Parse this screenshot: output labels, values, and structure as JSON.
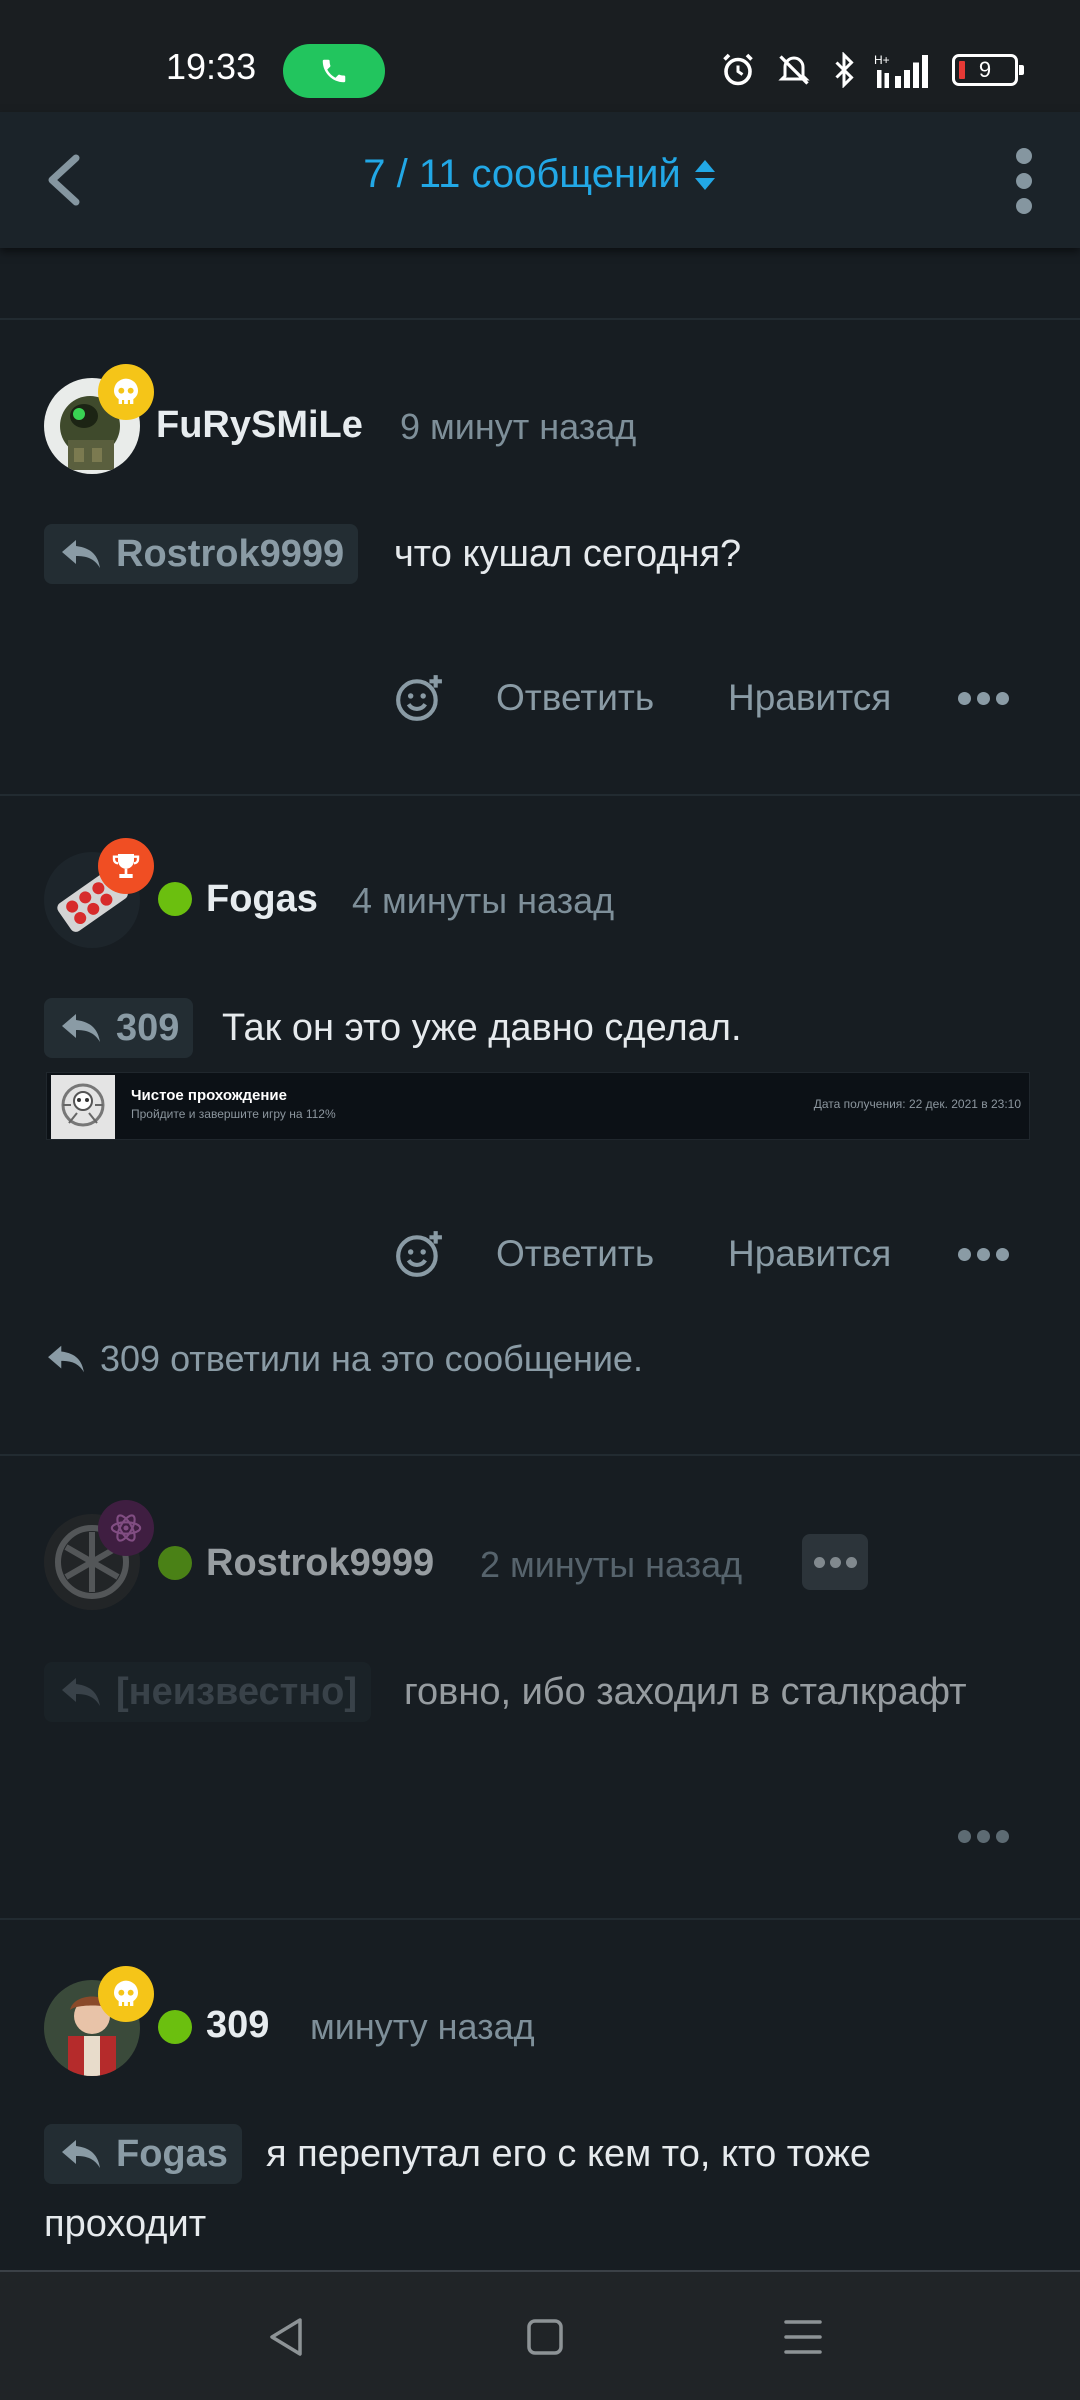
{
  "status_bar": {
    "time": "19:33",
    "battery_level": "9",
    "icons": [
      "phone-icon",
      "alarm-icon",
      "mute-icon",
      "bluetooth-icon",
      "signal-icon",
      "battery-icon"
    ]
  },
  "header": {
    "title": "7 / 11 сообщений",
    "back_icon": "chevron-left-icon",
    "sort_icon": "sort-updown-icon",
    "menu_icon": "more-vertical-icon"
  },
  "actions": {
    "reply": "Ответить",
    "like": "Нравится"
  },
  "posts": [
    {
      "username": "FuRySMiLe",
      "time": "9 минут назад",
      "badge": "skull-icon",
      "online": false,
      "quote": "Rostrok9999",
      "text": "что кушал сегодня?"
    },
    {
      "username": "Fogas",
      "time": "4 минуты назад",
      "badge": "trophy-icon",
      "online": true,
      "quote": "309",
      "text": "Так он это уже давно сделал.",
      "achievement": {
        "title": "Чистое прохождение",
        "desc": "Пройдите и завершите игру на 112%",
        "date": "Дата получения: 22 дек. 2021 в 23:10"
      },
      "replies_note": "309 ответили на это сообщение."
    },
    {
      "username": "Rostrok9999",
      "time": "2 минуты назад",
      "badge": "atom-icon",
      "online": true,
      "quote": "[неизвестно]",
      "text": "говно, ибо заходил в сталкрафт"
    },
    {
      "username": "309",
      "time": "минуту назад",
      "badge": "skull-icon",
      "online": true,
      "quote": "Fogas",
      "text_line1": "я перепутал его с кем то, кто тоже",
      "text_line2": "проходит"
    }
  ],
  "colors": {
    "background": "#171d22",
    "accent": "#22a8e6",
    "online": "#6bbf0f",
    "badge_gold": "#f5c518",
    "badge_orange": "#f04e23",
    "badge_purple": "#5a1f55"
  }
}
